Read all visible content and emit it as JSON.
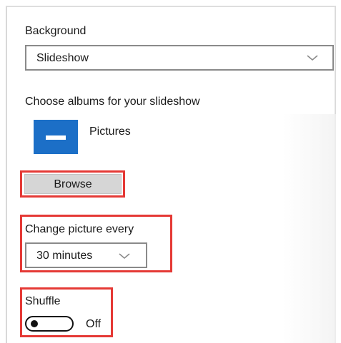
{
  "background": {
    "label": "Background",
    "selected": "Slideshow"
  },
  "albums": {
    "label": "Choose albums for your slideshow",
    "items": [
      {
        "name": "Pictures",
        "icon": "folder-icon"
      }
    ]
  },
  "browse": {
    "label": "Browse"
  },
  "change_picture": {
    "label": "Change picture every",
    "selected": "30 minutes"
  },
  "shuffle": {
    "label": "Shuffle",
    "state": "Off"
  },
  "colors": {
    "accent": "#1c6fc7",
    "highlight": "#e53935"
  }
}
